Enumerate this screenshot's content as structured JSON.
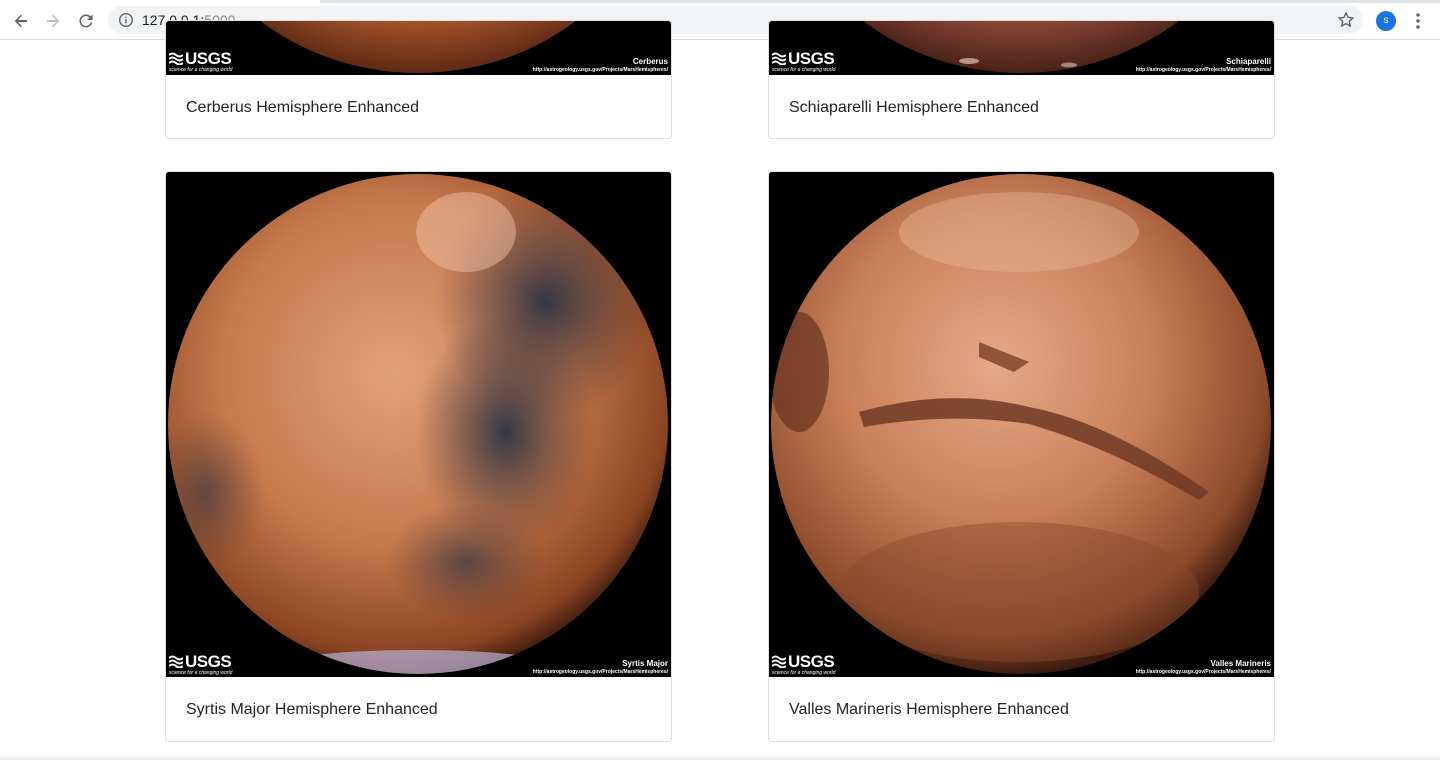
{
  "browser": {
    "url_host": "127.0.0.1:",
    "url_port": "5000",
    "profile_initial": "s",
    "icons": [
      "back-arrow-icon",
      "forward-arrow-icon",
      "reload-icon",
      "info-icon",
      "star-icon",
      "more-vert-icon"
    ]
  },
  "colors": {
    "mars_light": "#e09a6e",
    "mars_mid": "#c06a3a",
    "mars_dark": "#6a3420",
    "syrtis_dark": "#2a3448",
    "image_background": "#000000"
  },
  "cards": [
    {
      "title": "Cerberus Hemisphere Enhanced",
      "image_label": "Cerberus",
      "image_link": "http://astrogeology.usgs.gov/Projects/MarsHemispheres/",
      "logo": "USGS",
      "tagline": "science for a changing world"
    },
    {
      "title": "Schiaparelli Hemisphere Enhanced",
      "image_label": "Schiaparelli",
      "image_link": "http://astrogeology.usgs.gov/Projects/MarsHemispheres/",
      "logo": "USGS",
      "tagline": "science for a changing world"
    },
    {
      "title": "Syrtis Major Hemisphere Enhanced",
      "image_label": "Syrtis Major",
      "image_link": "http://astrogeology.usgs.gov/Projects/MarsHemispheres/",
      "logo": "USGS",
      "tagline": "science for a changing world"
    },
    {
      "title": "Valles Marineris Hemisphere Enhanced",
      "image_label": "Valles Marineris",
      "image_link": "http://astrogeology.usgs.gov/Projects/MarsHemispheres/",
      "logo": "USGS",
      "tagline": "science for a changing world"
    }
  ]
}
